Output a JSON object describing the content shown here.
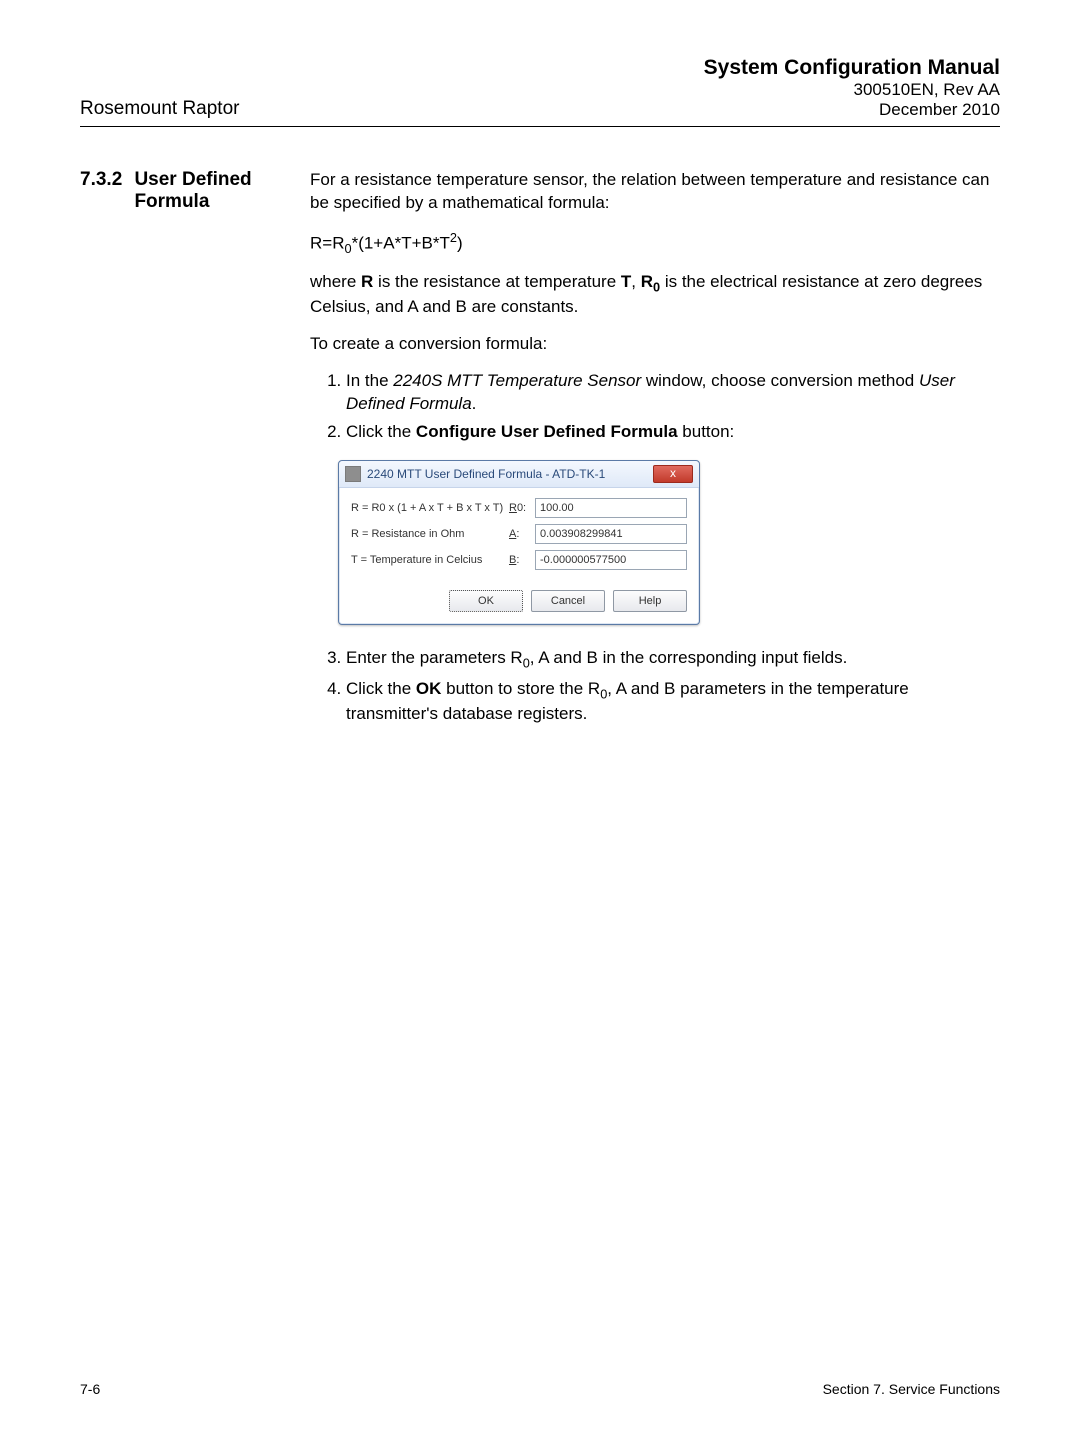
{
  "header": {
    "title": "System Configuration Manual",
    "doc_id": "300510EN, Rev AA",
    "date": "December 2010",
    "left": "Rosemount Raptor"
  },
  "section": {
    "num": "7.3.2",
    "title_line1": "User Defined",
    "title_line2": "Formula"
  },
  "paras": {
    "intro": "For a resistance temperature sensor, the relation between temperature and resistance can be specified by a mathematical formula:",
    "formula_prefix": "R=R",
    "formula_sub1": "0",
    "formula_rest": "*(1+A*T+B*T",
    "formula_sup": "2",
    "formula_close": ")",
    "where_1": "where ",
    "where_R": "R",
    "where_2": " is the resistance at temperature ",
    "where_T": "T",
    "where_3": ", ",
    "where_R0_pre": "R",
    "where_R0_sub": "0",
    "where_4": " is the electrical resistance at zero degrees Celsius, and A and B are constants.",
    "to_create": "To create a conversion formula:",
    "step1_pre": "In the ",
    "step1_ital": "2240S MTT Temperature Sensor",
    "step1_mid": " window, choose conversion method ",
    "step1_ital2": "User Defined Formula",
    "step1_end": ".",
    "step2_pre": "Click the ",
    "step2_bold": "Configure User Defined Formula",
    "step2_end": " button:",
    "step3_pre": "Enter the parameters R",
    "step3_sub": "0",
    "step3_end": ", A and B in the corresponding input fields.",
    "step4_pre": "Click the ",
    "step4_bold": "OK",
    "step4_mid": " button to store the R",
    "step4_sub": "0",
    "step4_end": ", A and B parameters in the temperature transmitter's database registers."
  },
  "dialog": {
    "title": "2240 MTT User Defined Formula - ATD-TK-1",
    "line1": "R = R0 x (1 + A x T + B x T x T)",
    "line2": "R = Resistance in Ohm",
    "line3": "T = Temperature in Celcius",
    "lbl_r0_u": "R",
    "lbl_r0_rest": "0:",
    "lbl_a_u": "A",
    "lbl_a_rest": ":",
    "lbl_b_u": "B",
    "lbl_b_rest": ":",
    "val_r0": "100.00",
    "val_a": "0.003908299841",
    "val_b": "-0.000000577500",
    "btn_ok": "OK",
    "btn_cancel": "Cancel",
    "btn_help": "Help",
    "btn_close": "x"
  },
  "footer": {
    "left": "7-6",
    "right": "Section 7. Service Functions"
  }
}
